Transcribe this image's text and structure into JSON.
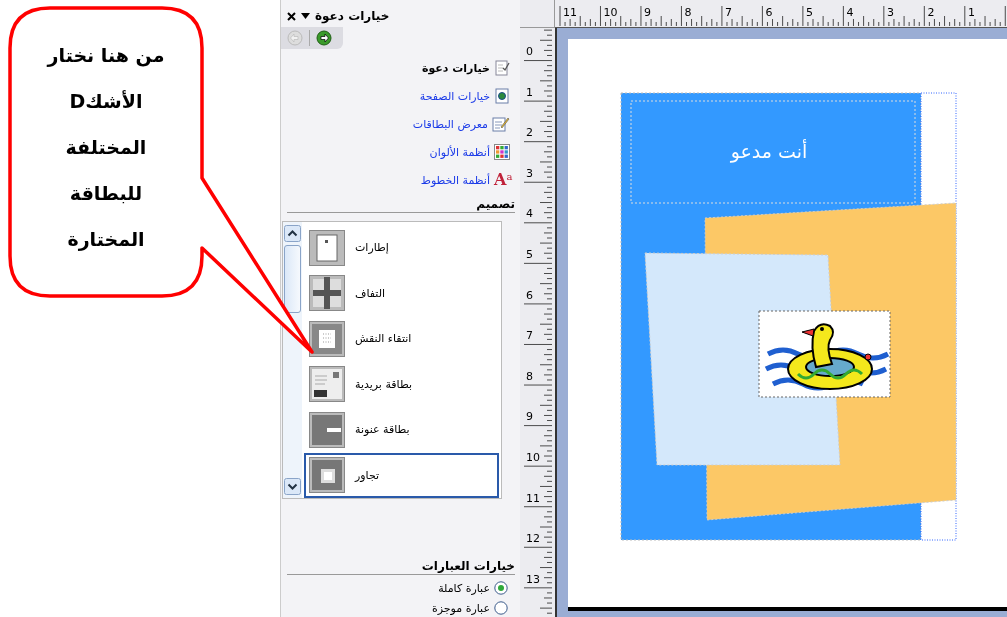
{
  "callout": {
    "lines": [
      "من هنا نختار",
      "الأشكD",
      "المختلفة",
      "للبطاقة",
      "المختارة"
    ]
  },
  "task_pane": {
    "title": "خيارات دعوة",
    "nav": [
      {
        "kind": "back",
        "disabled": true
      },
      {
        "kind": "forward",
        "disabled": false
      }
    ],
    "links": [
      {
        "label": "خيارات دعوة",
        "selected": true
      },
      {
        "label": "خيارات الصفحة",
        "selected": false
      },
      {
        "label": "معرض البطاقات",
        "selected": false
      },
      {
        "label": "أنظمة الألوان",
        "selected": false
      },
      {
        "label": "أنظمة الخطوط",
        "selected": false,
        "glyph": "Aa"
      }
    ],
    "design": {
      "heading": "تصميم",
      "items": [
        {
          "label": "إطارات",
          "selected": false
        },
        {
          "label": "التفاف",
          "selected": false
        },
        {
          "label": "انتقاء النقش",
          "selected": false
        },
        {
          "label": "بطاقة بريدية",
          "selected": false
        },
        {
          "label": "بطاقة عنونة",
          "selected": false
        },
        {
          "label": "تجاور",
          "selected": true
        }
      ]
    },
    "phrase_options": {
      "heading": "خيارات العبارات",
      "options": [
        {
          "label": "عبارة كاملة",
          "selected": true
        },
        {
          "label": "عبارة موجزة",
          "selected": false
        }
      ]
    }
  },
  "rulers": {
    "horizontal": [
      "1",
      "2",
      "3",
      "4",
      "5",
      "6",
      "7",
      "8",
      "9",
      "10",
      "11"
    ],
    "vertical": [
      "0",
      "1",
      "2",
      "3",
      "4",
      "5",
      "6",
      "7",
      "8",
      "9",
      "10",
      "11",
      "12",
      "13"
    ]
  },
  "card": {
    "title": "أنت مدعو"
  }
}
